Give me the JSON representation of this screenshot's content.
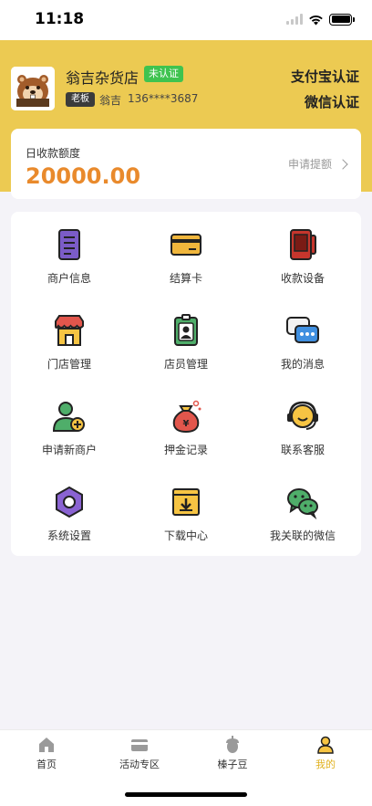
{
  "status_bar": {
    "time": "11:18",
    "icons": [
      "signal-icon",
      "wifi-icon",
      "battery-icon"
    ]
  },
  "header": {
    "store_name": "翁吉杂货店",
    "verify_badge": "未认证",
    "role_badge": "老板",
    "owner_name": "翁吉",
    "phone": "136****3687",
    "alipay_cert": "支付宝认证",
    "wechat_cert": "微信认证",
    "avatar_icon": "beaver-avatar-icon"
  },
  "quota": {
    "label": "日收款额度",
    "value": "20000.00",
    "withdraw_label": "申请提额"
  },
  "menu": [
    {
      "label": "商户信息",
      "icon": "document-icon"
    },
    {
      "label": "结算卡",
      "icon": "card-icon"
    },
    {
      "label": "收款设备",
      "icon": "pos-device-icon"
    },
    {
      "label": "门店管理",
      "icon": "store-icon"
    },
    {
      "label": "店员管理",
      "icon": "staff-badge-icon"
    },
    {
      "label": "我的消息",
      "icon": "message-icon"
    },
    {
      "label": "申请新商户",
      "icon": "add-user-icon"
    },
    {
      "label": "押金记录",
      "icon": "money-bag-icon"
    },
    {
      "label": "联系客服",
      "icon": "customer-service-icon"
    },
    {
      "label": "系统设置",
      "icon": "settings-icon"
    },
    {
      "label": "下载中心",
      "icon": "download-icon"
    },
    {
      "label": "我关联的微信",
      "icon": "wechat-icon"
    }
  ],
  "tabbar": [
    {
      "label": "首页",
      "icon": "home-icon"
    },
    {
      "label": "活动专区",
      "icon": "activity-card-icon"
    },
    {
      "label": "榛子豆",
      "icon": "hazelnut-icon"
    },
    {
      "label": "我的",
      "icon": "profile-icon",
      "active": true
    }
  ],
  "colors": {
    "header_bg": "#ecca52",
    "accent_orange": "#e98a2c",
    "verify_green": "#3fc34f",
    "active_tab": "#e1b11f",
    "page_bg": "#f4f3f8"
  }
}
